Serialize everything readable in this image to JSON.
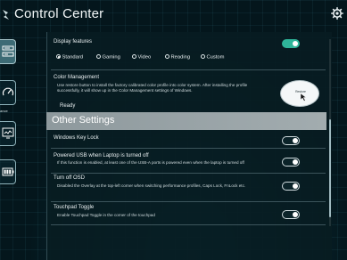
{
  "app": {
    "title": "Control Center"
  },
  "icons": {
    "logo": "app-logo-icon",
    "settings": "gear-icon",
    "sidebar": [
      "dashboard-icon",
      "speedometer-icon",
      "monitor-icon",
      "battery-icon"
    ]
  },
  "sidebar": {
    "items": [
      {
        "name": "dashboard",
        "active": true,
        "label": ""
      },
      {
        "name": "performance",
        "active": false,
        "label": "ance"
      },
      {
        "name": "display",
        "active": false,
        "label": ""
      },
      {
        "name": "battery",
        "active": false,
        "label": ""
      }
    ]
  },
  "display_features": {
    "label": "Display features",
    "toggle_on": true,
    "modes": [
      {
        "label": "Standard",
        "checked": true
      },
      {
        "label": "Gaming",
        "checked": false
      },
      {
        "label": "Video",
        "checked": false
      },
      {
        "label": "Reading",
        "checked": false
      },
      {
        "label": "Custom",
        "checked": false
      }
    ]
  },
  "color_management": {
    "label": "Color Management",
    "description": "Use restore button to install the factory calibrated color profile into color system. After installing the profile successfully, it will show up in the Color Management settings of Windows.",
    "status": "Ready",
    "button_label": "Restore"
  },
  "other_settings": {
    "title": "Other Settings",
    "items": [
      {
        "label": "Windows Key Lock",
        "description": "",
        "on": false
      },
      {
        "label": "Powered USB when Laptop is turned off",
        "description": "If this function is enabled, at least one of the USB-A ports is powered even when the laptop is turned off",
        "on": false
      },
      {
        "label": "Turn off OSD",
        "description": "Disabled the Overlay at the top-left corner when switching performance profiles, Caps Lock, FnLock etc.",
        "on": false
      },
      {
        "label": "Touchpad Toggle",
        "description": "Enable Touchpad Toggle in the corner of the touchpad",
        "on": false
      }
    ]
  },
  "colors": {
    "accent": "#2fb59a",
    "background": "#04161c",
    "section_header": "#9aa5a8"
  }
}
